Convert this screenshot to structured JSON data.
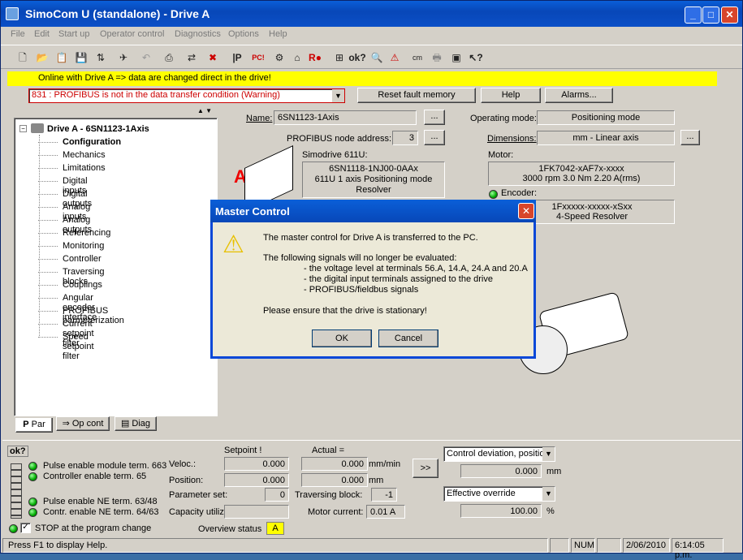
{
  "title": "SimoCom U (standalone) - Drive A",
  "menu": [
    "File",
    "Edit",
    "Start up",
    "Operator control",
    "Diagnostics",
    "Options",
    "Help"
  ],
  "online_banner": "Online with Drive A => data are changed direct in the drive!",
  "fault": {
    "text": "831 : PROFIBUS is not in the data transfer condition (Warning)",
    "reset": "Reset fault memory",
    "help": "Help",
    "alarms": "Alarms..."
  },
  "tree": {
    "root": "Drive A - 6SN1123-1Axis",
    "items": [
      "Configuration",
      "Mechanics",
      "Limitations",
      "Digital inputs",
      "Digital outputs",
      "Analog inputs",
      "Analog outputs",
      "Referencing",
      "Monitoring",
      "Controller",
      "Traversing blocks",
      "Couplings",
      "Angular encoder interface",
      "PROFIBUS parmeterization",
      "Current setpoint filter",
      "Speed setpoint filter"
    ]
  },
  "tabs": [
    "Par",
    "Op cont",
    "Diag"
  ],
  "config": {
    "name_label": "Name:",
    "name": "6SN1123-1Axis",
    "node_label": "PROFIBUS node address:",
    "node": "3",
    "mode_label": "Operating mode:",
    "mode": "Positioning mode",
    "dim_label": "Dimensions:",
    "dim": "mm - Linear axis",
    "simo_label": "Simodrive 611U:",
    "simo": [
      "6SN1118-1NJ00-0AAx",
      "611U 1 axis Positioning mode",
      "Resolver"
    ],
    "motor_label": "Motor:",
    "motor": [
      "1FK7042-xAF7x-xxxx",
      "3000 rpm   3.0 Nm  2.20 A(rms)"
    ],
    "enc_label": "Encoder:",
    "enc": [
      "1Fxxxxx-xxxxx-xSxx",
      "4-Speed    Resolver"
    ],
    "drive_letter": "A",
    "ellipsis": "..."
  },
  "dialog": {
    "title": "Master Control",
    "l1": "The master control for Drive A is transferred to the PC.",
    "l2": "The following signals will no longer be evaluated:",
    "b1": "- the voltage level at terminals 56.A, 14.A, 24.A and 20.A",
    "b2": "- the digital input terminals assigned to the drive",
    "b3": "- PROFIBUS/fieldbus signals",
    "l3": "Please ensure that the drive is stationary!",
    "ok": "OK",
    "cancel": "Cancel"
  },
  "bottom": {
    "ok": "ok?",
    "pulse_mod": "Pulse enable module term. 663",
    "ctrl_en": "Controller enable term. 65",
    "pulse_ne": "Pulse enable NE term. 63/48",
    "contr_ne": "Contr. enable NE term. 64/63",
    "setpoint": "Setpoint !",
    "actual": "Actual =",
    "veloc": "Veloc.:",
    "veloc_set": "0.000",
    "veloc_act": "0.000",
    "veloc_unit": "mm/min",
    "position": "Position:",
    "pos_set": "0.000",
    "pos_act": "0.000",
    "pos_unit": "mm",
    "param_set": "Parameter set:",
    "param_val": "0",
    "trav_block": "Traversing block:",
    "trav_val": "-1",
    "capacity": "Capacity utiliz",
    "motor_cur": "Motor current:",
    "motor_val": "0.01 A",
    "arrow": ">>",
    "sel1": "Control deviation, positio",
    "sel1_val": "0.000",
    "sel1_unit": "mm",
    "sel2": "Effective override",
    "sel2_val": "100.00",
    "sel2_unit": "%",
    "stop": "STOP at the program change",
    "overview": "Overview status",
    "overview_val": "A"
  },
  "status": {
    "help": "Press F1 to display Help.",
    "num": "NUM",
    "date": "2/06/2010",
    "time": "6:14:05 p.m."
  }
}
